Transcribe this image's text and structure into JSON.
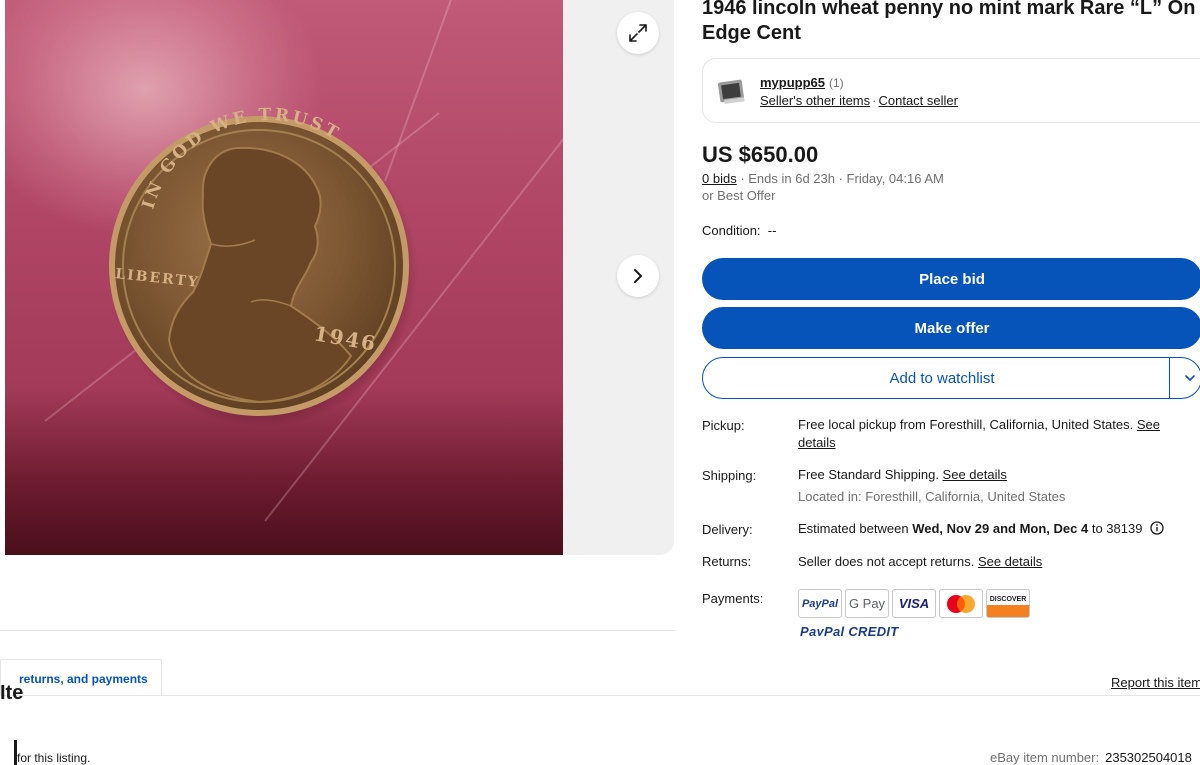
{
  "listing": {
    "title": "1946 lincoln wheat penny no mint mark Rare “L” On Edge Cent",
    "photo_alt": "1946 Lincoln wheat penny photo",
    "coin_text": {
      "motto": "IN GOD WE TRUST",
      "liberty": "LIBERTY",
      "year": "1946"
    }
  },
  "gallery": {
    "expand_icon": "expand-diagonal-icon",
    "next_icon": "chevron-right-icon"
  },
  "seller": {
    "name": "mypupp65",
    "feedback_count": "(1)",
    "other_items_label": "Seller's other items",
    "separator": "·",
    "contact_label": "Contact seller"
  },
  "pricing": {
    "price": "US $650.00",
    "bids": "0 bids",
    "ends": " · Ends in 6d 23h · Friday, 04:16 AM",
    "best_offer": "or Best Offer",
    "condition_label": "Condition:",
    "condition_value": "--"
  },
  "actions": {
    "place_bid": "Place bid",
    "make_offer": "Make offer",
    "add_watchlist": "Add to watchlist"
  },
  "details": {
    "pickup_label": "Pickup:",
    "pickup_text": "Free local pickup from Foresthill, California, United States. ",
    "pickup_link": "See details",
    "shipping_label": "Shipping:",
    "shipping_text": "Free Standard Shipping. ",
    "shipping_link": "See details",
    "shipping_location": "Located in: Foresthill, California, United States",
    "delivery_label": "Delivery:",
    "delivery_prefix": "Estimated between ",
    "delivery_dates": "Wed, Nov 29 and Mon, Dec 4",
    "delivery_suffix": " to 38139",
    "returns_label": "Returns:",
    "returns_text": "Seller does not accept returns. ",
    "returns_link": "See details",
    "payments_label": "Payments:",
    "payment_methods": [
      "PayPal",
      "G Pay",
      "VISA",
      "Mastercard",
      "DISCOVER"
    ],
    "paypal_credit": "PayPal CREDIT"
  },
  "lower": {
    "tab_label": "returns, and payments",
    "report_label": "Report this item",
    "heading_fragment": "Ite",
    "listing_note": "for this listing.",
    "item_number_label": "eBay item number:",
    "item_number": "235302504018"
  },
  "colors": {
    "primary_blue": "#0654ba",
    "text": "#191919",
    "muted": "#707070"
  }
}
